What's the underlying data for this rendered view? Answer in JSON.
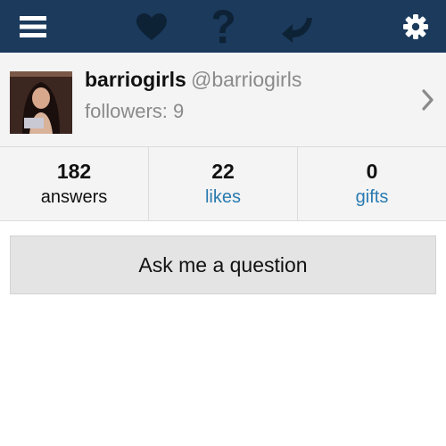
{
  "colors": {
    "topbar_bg": "#1b3a5c",
    "icon_white": "#ffffff",
    "icon_dark": "#0e2236",
    "link": "#2a7ab0",
    "muted": "#8a8a8a"
  },
  "topbar": {
    "icons": [
      "menu-icon",
      "heart-icon",
      "question-icon",
      "reply-icon",
      "gear-icon"
    ]
  },
  "profile": {
    "username": "barriogirls",
    "handle": "@barriogirls",
    "followers_text": "followers: 9"
  },
  "stats": [
    {
      "value": "182",
      "label": "answers"
    },
    {
      "value": "22",
      "label": "likes"
    },
    {
      "value": "0",
      "label": "gifts"
    }
  ],
  "ask_button": {
    "label": "Ask me a question"
  }
}
